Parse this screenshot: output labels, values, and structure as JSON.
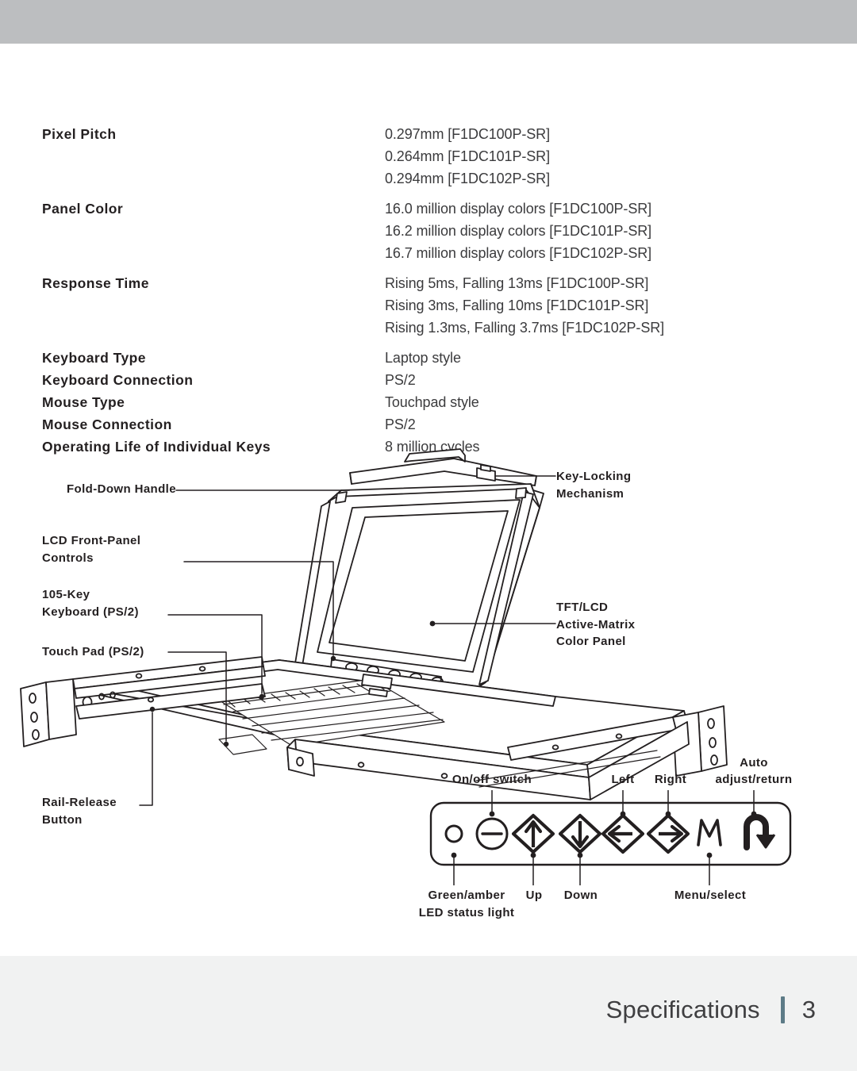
{
  "page": {
    "footer_title": "Specifications",
    "footer_page": "3"
  },
  "specs": [
    {
      "label": "Pixel Pitch",
      "values": [
        "0.297mm [F1DC100P-SR]",
        "0.264mm [F1DC101P-SR]",
        "0.294mm [F1DC102P-SR]"
      ]
    },
    {
      "label": "Panel Color",
      "values": [
        "16.0 million display colors [F1DC100P-SR]",
        "16.2 million display colors [F1DC101P-SR]",
        "16.7 million display colors [F1DC102P-SR]"
      ]
    },
    {
      "label": "Response Time",
      "values": [
        "Rising 5ms, Falling 13ms [F1DC100P-SR]",
        "Rising 3ms, Falling 10ms [F1DC101P-SR]",
        "Rising 1.3ms, Falling 3.7ms [F1DC102P-SR]"
      ]
    },
    {
      "label": "Keyboard Type",
      "values": [
        "Laptop style"
      ]
    },
    {
      "label": "Keyboard Connection",
      "values": [
        "PS/2"
      ]
    },
    {
      "label": "Mouse Type",
      "values": [
        "Touchpad style"
      ]
    },
    {
      "label": "Mouse Connection",
      "values": [
        "PS/2"
      ]
    },
    {
      "label": "Operating Life of Individual Keys",
      "values": [
        "8 million cycles"
      ]
    }
  ],
  "diagram": {
    "callouts": {
      "fold_down_handle": "Fold-Down Handle",
      "lcd_front_panel_controls": "LCD Front-Panel\nControls",
      "keyboard_105": "105-Key\nKeyboard (PS/2)",
      "touch_pad": "Touch Pad (PS/2)",
      "rail_release": "Rail-Release\nButton",
      "key_locking": "Key-Locking\nMechanism",
      "tft_lcd": "TFT/LCD\nActive-Matrix\nColor Panel"
    }
  },
  "control_panel": {
    "labels_top": {
      "on_off": "On/off switch",
      "left": "Left",
      "right": "Right",
      "auto_line1": "Auto",
      "auto_line2": "adjust/return"
    },
    "labels_bottom": {
      "led": "Green/amber\nLED status light",
      "up": "Up",
      "down": "Down",
      "menu": "Menu/select"
    },
    "buttons": [
      {
        "name": "led-indicator",
        "glyph": "circle-outline"
      },
      {
        "name": "power-button",
        "glyph": "circle-minus"
      },
      {
        "name": "up-button",
        "glyph": "diamond-arrow-up"
      },
      {
        "name": "down-button",
        "glyph": "diamond-arrow-down"
      },
      {
        "name": "left-button",
        "glyph": "diamond-arrow-left"
      },
      {
        "name": "right-button",
        "glyph": "diamond-arrow-right"
      },
      {
        "name": "menu-button",
        "glyph": "letter-m"
      },
      {
        "name": "auto-return-button",
        "glyph": "return-arrow"
      }
    ]
  },
  "colors": {
    "top_band": "#bcbec0",
    "bottom_band": "#f1f2f2",
    "ink": "#231f20",
    "footer_divider": "#5d7b87"
  }
}
